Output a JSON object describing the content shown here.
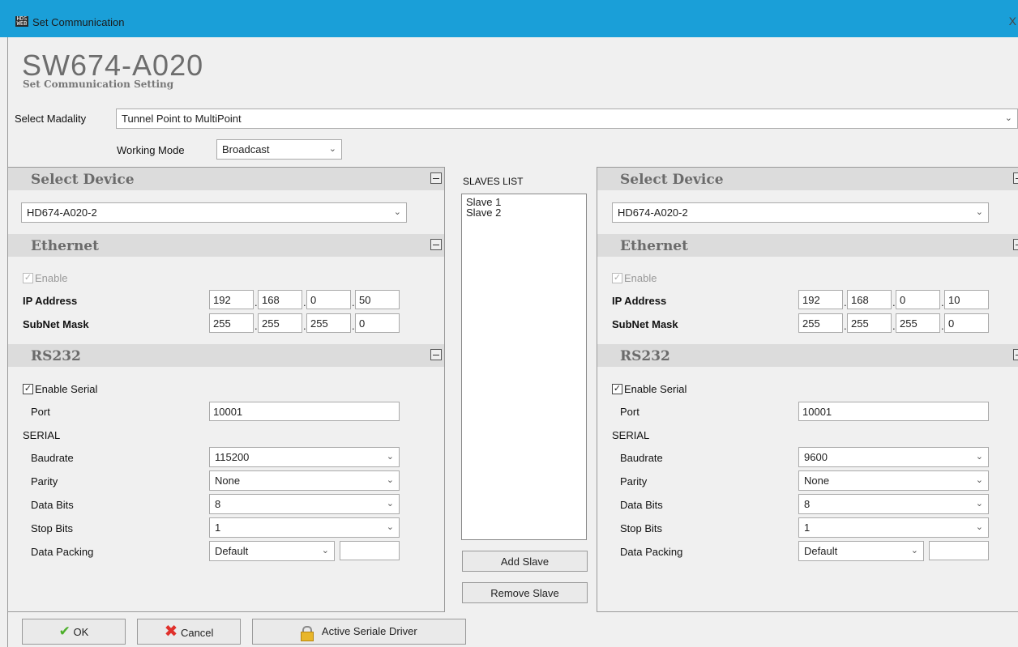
{
  "window": {
    "title": "Set Communication",
    "app_icon_text": "HDS WEB",
    "close_glyph": "X"
  },
  "header": {
    "product": "SW674-A020",
    "subtitle": "Set Communication Setting"
  },
  "modality": {
    "label": "Select Madality",
    "value": "Tunnel Point to MultiPoint"
  },
  "working_mode": {
    "label": "Working Mode",
    "value": "Broadcast"
  },
  "slaves": {
    "title": "SLAVES LIST",
    "items": [
      "Slave 1",
      "Slave 2"
    ],
    "add_label": "Add Slave",
    "remove_label": "Remove Slave"
  },
  "left": {
    "select_device_title": "Select Device",
    "device": "HD674-A020-2",
    "ethernet_title": "Ethernet",
    "enable_label": "Enable",
    "ip_label": "IP Address",
    "ip": [
      "192",
      "168",
      "0",
      "50"
    ],
    "mask_label": "SubNet Mask",
    "mask": [
      "255",
      "255",
      "255",
      "0"
    ],
    "rs232_title": "RS232",
    "enable_serial_label": "Enable Serial",
    "port_label": "Port",
    "port": "10001",
    "serial_label": "SERIAL",
    "baudrate_label": "Baudrate",
    "baudrate": "115200",
    "parity_label": "Parity",
    "parity": "None",
    "databits_label": "Data Bits",
    "databits": "8",
    "stopbits_label": "Stop Bits",
    "stopbits": "1",
    "packing_label": "Data Packing",
    "packing": "Default",
    "packing_extra": ""
  },
  "right": {
    "select_device_title": "Select Device",
    "device": "HD674-A020-2",
    "ethernet_title": "Ethernet",
    "enable_label": "Enable",
    "ip_label": "IP Address",
    "ip": [
      "192",
      "168",
      "0",
      "10"
    ],
    "mask_label": "SubNet Mask",
    "mask": [
      "255",
      "255",
      "255",
      "0"
    ],
    "rs232_title": "RS232",
    "enable_serial_label": "Enable Serial",
    "port_label": "Port",
    "port": "10001",
    "serial_label": "SERIAL",
    "baudrate_label": "Baudrate",
    "baudrate": "9600",
    "parity_label": "Parity",
    "parity": "None",
    "databits_label": "Data Bits",
    "databits": "8",
    "stopbits_label": "Stop Bits",
    "stopbits": "1",
    "packing_label": "Data Packing",
    "packing": "Default",
    "packing_extra": ""
  },
  "footer": {
    "ok_label": "OK",
    "cancel_label": "Cancel",
    "driver_label": "Active Seriale Driver"
  }
}
